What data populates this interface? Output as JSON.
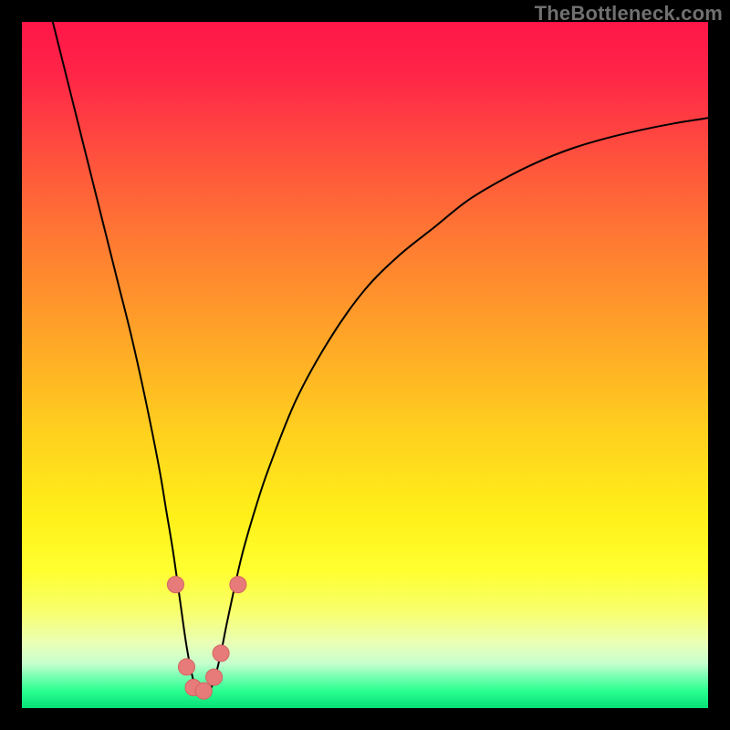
{
  "watermark": "TheBottleneck.com",
  "colors": {
    "frame": "#000000",
    "curve": "#000000",
    "marker_fill": "#e77b79",
    "marker_stroke": "#d46361"
  },
  "gradient_stops": [
    {
      "offset": 0.0,
      "color": "#ff1648"
    },
    {
      "offset": 0.08,
      "color": "#ff2647"
    },
    {
      "offset": 0.18,
      "color": "#ff4b3f"
    },
    {
      "offset": 0.3,
      "color": "#ff7434"
    },
    {
      "offset": 0.45,
      "color": "#ffa228"
    },
    {
      "offset": 0.6,
      "color": "#ffd11e"
    },
    {
      "offset": 0.72,
      "color": "#fff019"
    },
    {
      "offset": 0.8,
      "color": "#ffff30"
    },
    {
      "offset": 0.86,
      "color": "#f8ff6e"
    },
    {
      "offset": 0.905,
      "color": "#eaffb6"
    },
    {
      "offset": 0.935,
      "color": "#c6ffce"
    },
    {
      "offset": 0.955,
      "color": "#74ffb0"
    },
    {
      "offset": 0.975,
      "color": "#2bff90"
    },
    {
      "offset": 1.0,
      "color": "#05e076"
    }
  ],
  "chart_data": {
    "type": "line",
    "title": "",
    "xlabel": "",
    "ylabel": "",
    "xlim": [
      0,
      100
    ],
    "ylim": [
      0,
      100
    ],
    "series": [
      {
        "name": "curve",
        "x": [
          4,
          6,
          8,
          10,
          12,
          14,
          16,
          18,
          20,
          21,
          22,
          23,
          24,
          25,
          26,
          27,
          28,
          29,
          30,
          32,
          34,
          36,
          40,
          45,
          50,
          55,
          60,
          65,
          70,
          75,
          80,
          85,
          90,
          95,
          100
        ],
        "y": [
          102,
          94,
          86,
          78,
          70,
          62,
          54,
          45,
          35,
          29,
          23,
          16,
          9,
          4,
          2,
          2,
          4,
          8,
          13,
          22,
          29,
          35,
          45,
          54,
          61,
          66,
          70,
          74,
          77,
          79.5,
          81.5,
          83,
          84.2,
          85.2,
          86
        ]
      }
    ],
    "markers": [
      {
        "x": 22.4,
        "y": 18.0,
        "r": 1.2
      },
      {
        "x": 24.0,
        "y": 6.0,
        "r": 1.2
      },
      {
        "x": 25.0,
        "y": 3.0,
        "r": 1.2
      },
      {
        "x": 26.5,
        "y": 2.5,
        "r": 1.2
      },
      {
        "x": 28.0,
        "y": 4.5,
        "r": 1.2
      },
      {
        "x": 29.0,
        "y": 8.0,
        "r": 1.2
      },
      {
        "x": 31.5,
        "y": 18.0,
        "r": 1.2
      }
    ]
  }
}
